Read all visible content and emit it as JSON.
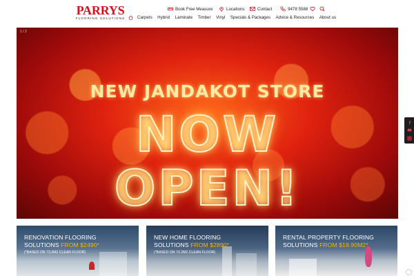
{
  "header": {
    "logo_main": "PARRYS",
    "logo_sub": "FLOORING SOLUTIONS",
    "utility": {
      "book": "Book Free Measure",
      "locations": "Locations",
      "contact": "Contact",
      "phone": "9478 5588"
    },
    "nav": [
      "Carpets",
      "Hybrid",
      "Laminate",
      "Timber",
      "Vinyl",
      "Specials & Packages",
      "Advice & Resources",
      "About us"
    ]
  },
  "hero": {
    "counter": "1 / 2",
    "line1": "NEW JANDAKOT STORE",
    "line2": "NOW",
    "line3": "OPEN!"
  },
  "cards": [
    {
      "title_a": "RENOVATION FLOORING",
      "title_b": "SOLUTIONS ",
      "price": "FROM $2490*",
      "note": "(*BASED ON 73.2M2 CLEAN FLOOR)"
    },
    {
      "title_a": "NEW HOME FLOORING",
      "title_b": "SOLUTIONS ",
      "price": "FROM $2890*",
      "note": "(*BASED ON 73.2M2 CLEAN FLOOR)"
    },
    {
      "title_a": "RENTAL PROPERTY FLOORING",
      "title_b": "SOLUTIONS ",
      "price": "FROM $18.90M2*",
      "note": ""
    }
  ],
  "colors": {
    "brand_red": "#d3121e",
    "price_highlight": "#f7b500",
    "hero_text": "#ffe9a6"
  },
  "icons": [
    "home-icon",
    "measure-icon",
    "location-pin-icon",
    "mail-icon",
    "phone-icon",
    "heart-icon",
    "search-icon",
    "facebook-icon",
    "youtube-icon",
    "instagram-icon"
  ]
}
